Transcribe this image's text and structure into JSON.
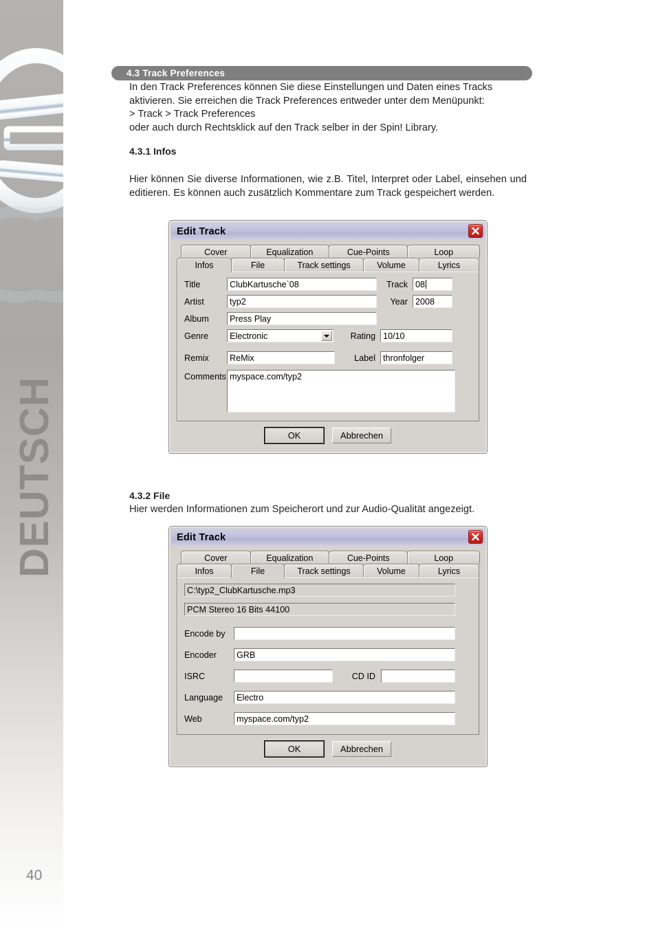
{
  "sidebar": {
    "language_label": "DEUTSCH",
    "page_number": "40",
    "logo_name": "reloop-metallic-logo"
  },
  "sections": {
    "s43": {
      "bar_title": "4.3 Track Preferences",
      "paragraph": "In den Track Preferences können Sie diese Einstellungen und Daten eines Tracks aktivieren. Sie erreichen die Track Preferences entweder unter dem Menüpunkt:\n> Track > Track Preferences\noder auch durch Rechtsklick auf den Track selber in der Spin! Library."
    },
    "s431": {
      "heading": "4.3.1 Infos",
      "paragraph": "Hier können Sie diverse Informationen, wie z.B. Titel, Interpret oder Label, einsehen und editieren. Es können auch zusätzlich Kommentare zum Track gespeichert werden."
    },
    "s432": {
      "heading": "4.3.2 File",
      "paragraph": "Hier werden Informationen zum Speicherort und zur Audio-Qualität angezeigt."
    }
  },
  "dialog_infos": {
    "title": "Edit Track",
    "close_label": "close-icon",
    "tabs_row1": [
      "Cover",
      "Equalization",
      "Cue-Points",
      "Loop"
    ],
    "tabs_row2": [
      "Infos",
      "File",
      "Track settings",
      "Volume",
      "Lyrics"
    ],
    "active_tab": "Infos",
    "fields": {
      "title_label": "Title",
      "title_value": "ClubKartusche`08",
      "track_label": "Track",
      "track_value": "08",
      "artist_label": "Artist",
      "artist_value": "typ2",
      "year_label": "Year",
      "year_value": "2008",
      "album_label": "Album",
      "album_value": "Press Play",
      "genre_label": "Genre",
      "genre_value": "Electronic",
      "rating_label": "Rating",
      "rating_value": "10/10",
      "remix_label": "Remix",
      "remix_value": "ReMix",
      "label_label": "Label",
      "label_value": "thronfolger",
      "comments_label": "Comments",
      "comments_value": "myspace.com/typ2"
    },
    "buttons": {
      "ok": "OK",
      "cancel": "Abbrechen"
    }
  },
  "dialog_file": {
    "title": "Edit Track",
    "close_label": "close-icon",
    "tabs_row1": [
      "Cover",
      "Equalization",
      "Cue-Points",
      "Loop"
    ],
    "tabs_row2": [
      "Infos",
      "File",
      "Track settings",
      "Volume",
      "Lyrics"
    ],
    "active_tab": "File",
    "fields": {
      "path_value": "C:\\typ2_ClubKartusche.mp3",
      "format_value": "PCM Stereo  16 Bits  44100",
      "encodeby_label": "Encode by",
      "encodeby_value": "",
      "encoder_label": "Encoder",
      "encoder_value": "GRB",
      "isrc_label": "ISRC",
      "isrc_value": "",
      "cdid_label": "CD ID",
      "cdid_value": "",
      "language_label": "Language",
      "language_value": "Electro",
      "web_label": "Web",
      "web_value": "myspace.com/typ2"
    },
    "buttons": {
      "ok": "OK",
      "cancel": "Abbrechen"
    }
  },
  "colors": {
    "section_bar": "#807f7f",
    "titlebar": "#c0c0dc",
    "dialog_face": "#d6d3ce",
    "close_red": "#cf2a24",
    "deutsch_gray": "#8e8d8c"
  }
}
